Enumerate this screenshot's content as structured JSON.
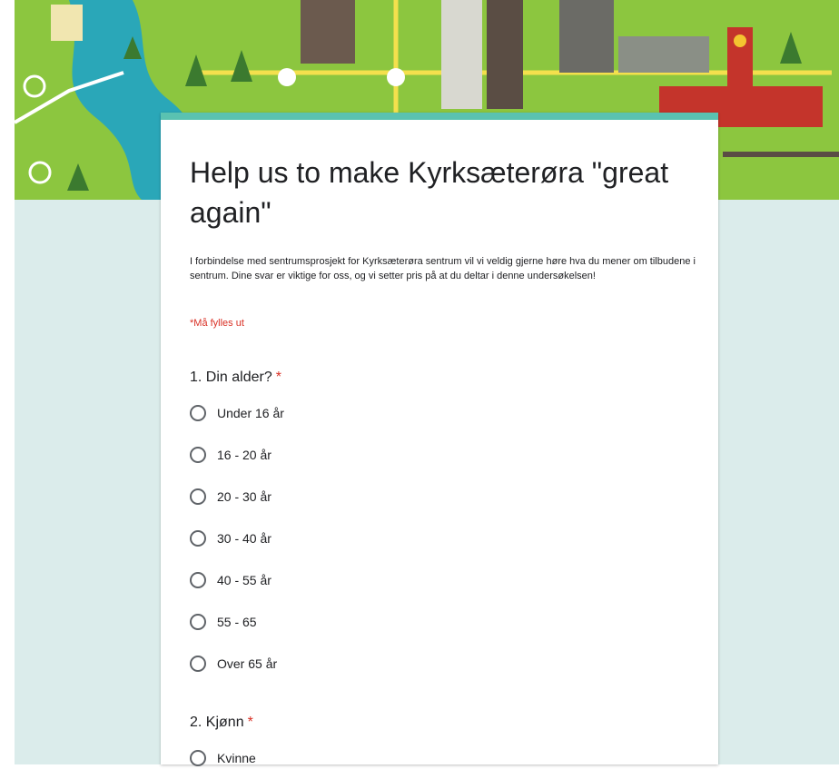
{
  "colors": {
    "page_background": "#dbeceb",
    "card_accent": "#5ac2b1",
    "required": "#d93025",
    "text": "#202124"
  },
  "header": {
    "banner_image": "city-map-illustration"
  },
  "form": {
    "title": "Help us to make Kyrksæterøra \"great again\"",
    "description": "I forbindelse med sentrumsprosjekt for Kyrksæterøra sentrum vil vi veldig gjerne høre hva du mener om tilbudene i sentrum. Dine svar er viktige for oss, og vi setter pris på at du deltar i denne undersøkelsen!",
    "required_note": "*Må fylles ut"
  },
  "questions": [
    {
      "title": "1. Din alder?",
      "required_mark": "*",
      "options": [
        "Under 16 år",
        "16 - 20 år",
        "20 - 30 år",
        "30 - 40 år",
        "40 - 55 år",
        "55 - 65",
        "Over 65 år"
      ]
    },
    {
      "title": "2. Kjønn",
      "required_mark": "*",
      "options": [
        "Kvinne"
      ]
    }
  ]
}
